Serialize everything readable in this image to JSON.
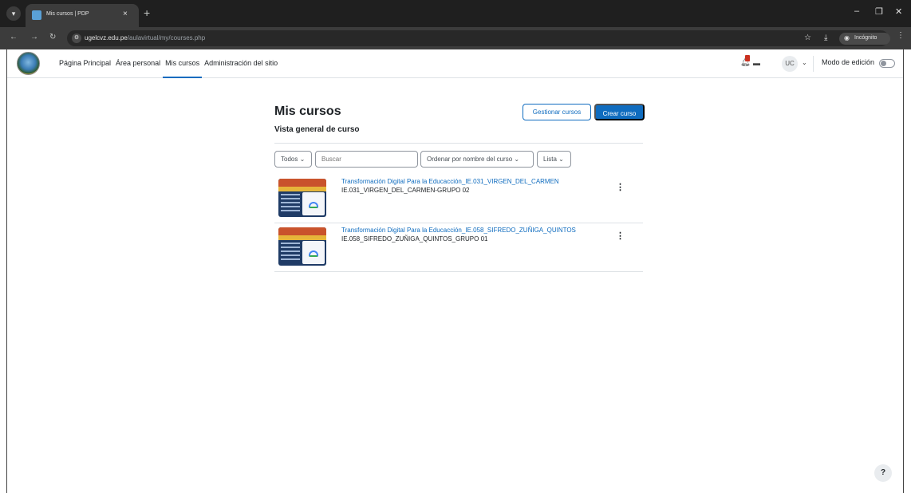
{
  "browser": {
    "tab_title": "Mis cursos | PDP",
    "tab_close": "×",
    "new_tab": "+",
    "url_host": "ugelcvz.edu.pe",
    "url_path": "/aulavirtual/my/courses.php",
    "incognito_label": "Incógnito",
    "window_minimize": "–",
    "window_restore": "❐",
    "window_close": "✕"
  },
  "navbar": {
    "links": [
      "Página Principal",
      "Área personal",
      "Mis cursos",
      "Administración del sitio"
    ],
    "active_index": 2,
    "user_initials": "UC",
    "edit_mode_label": "Modo de edición",
    "edit_mode_on": false
  },
  "page": {
    "title": "Mis cursos",
    "manage_button": "Gestionar cursos",
    "create_button": "Crear curso",
    "section_title": "Vista general de curso"
  },
  "filters": {
    "grouping": "Todos",
    "search_placeholder": "Buscar",
    "sort": "Ordenar por nombre del curso",
    "view": "Lista"
  },
  "courses": [
    {
      "name": "Transformación Digital Para la Educacción_IE.031_VIRGEN_DEL_CARMEN",
      "category": "IE.031_VIRGEN_DEL_CARMEN-GRUPO 02"
    },
    {
      "name": "Transformación Digital Para la Educacción_IE.058_SIFREDO_ZUÑIGA_QUINTOS",
      "category": "IE.058_SIFREDO_ZUÑIGA_QUINTOS_GRUPO 01"
    }
  ],
  "help_label": "?",
  "colors": {
    "primary": "#0f6cbf",
    "chrome_dark": "#1f1f1f",
    "badge_red": "#ca3120"
  }
}
